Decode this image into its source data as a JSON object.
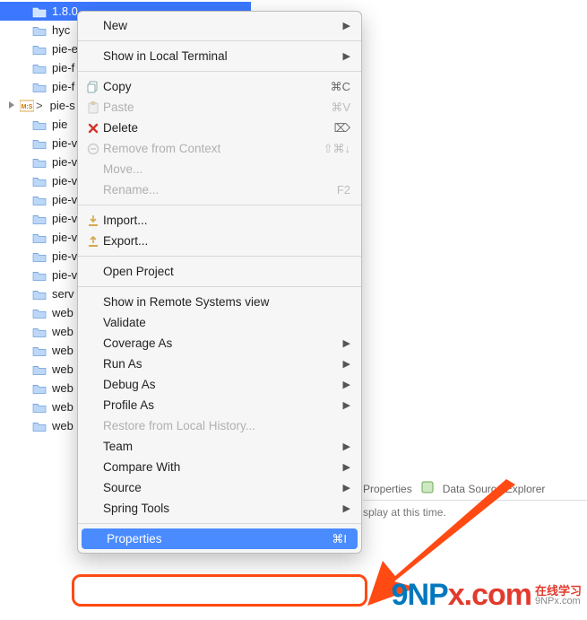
{
  "tree": {
    "selected_label": "1.8.0",
    "items": [
      {
        "label": "hyc"
      },
      {
        "label": "pie-e"
      },
      {
        "label": "pie-f"
      },
      {
        "label": "pie-f"
      },
      {
        "label": "pie-s",
        "dirty": true,
        "special": true
      },
      {
        "label": "pie"
      },
      {
        "label": "pie-v"
      },
      {
        "label": "pie-v"
      },
      {
        "label": "pie-v"
      },
      {
        "label": "pie-v"
      },
      {
        "label": "pie-v"
      },
      {
        "label": "pie-v"
      },
      {
        "label": "pie-v"
      },
      {
        "label": "pie-v"
      },
      {
        "label": "serv"
      },
      {
        "label": "web"
      },
      {
        "label": "web"
      },
      {
        "label": "web"
      },
      {
        "label": "web"
      },
      {
        "label": "web"
      },
      {
        "label": "web"
      },
      {
        "label": "web"
      }
    ]
  },
  "menu": {
    "new": "New",
    "show_terminal": "Show in Local Terminal",
    "copy": "Copy",
    "copy_sc": "⌘C",
    "paste": "Paste",
    "paste_sc": "⌘V",
    "delete": "Delete",
    "delete_sc": "⌦",
    "remove_ctx": "Remove from Context",
    "remove_ctx_sc": "⇧⌘↓",
    "move": "Move...",
    "rename": "Rename...",
    "rename_sc": "F2",
    "import": "Import...",
    "export": "Export...",
    "open_project": "Open Project",
    "remote_systems": "Show in Remote Systems view",
    "validate": "Validate",
    "coverage_as": "Coverage As",
    "run_as": "Run As",
    "debug_as": "Debug As",
    "profile_as": "Profile As",
    "restore_local": "Restore from Local History...",
    "team": "Team",
    "compare_with": "Compare With",
    "source": "Source",
    "spring_tools": "Spring Tools",
    "properties": "Properties",
    "properties_sc": "⌘I"
  },
  "rpanel": {
    "tab1": "Properties",
    "tab2": "Data Source Explorer",
    "body": "splay at this time."
  },
  "watermark": {
    "logo_a": "9NP",
    "logo_b": "x.com",
    "cn": "在线学习",
    "sub": "9NPx.com"
  }
}
